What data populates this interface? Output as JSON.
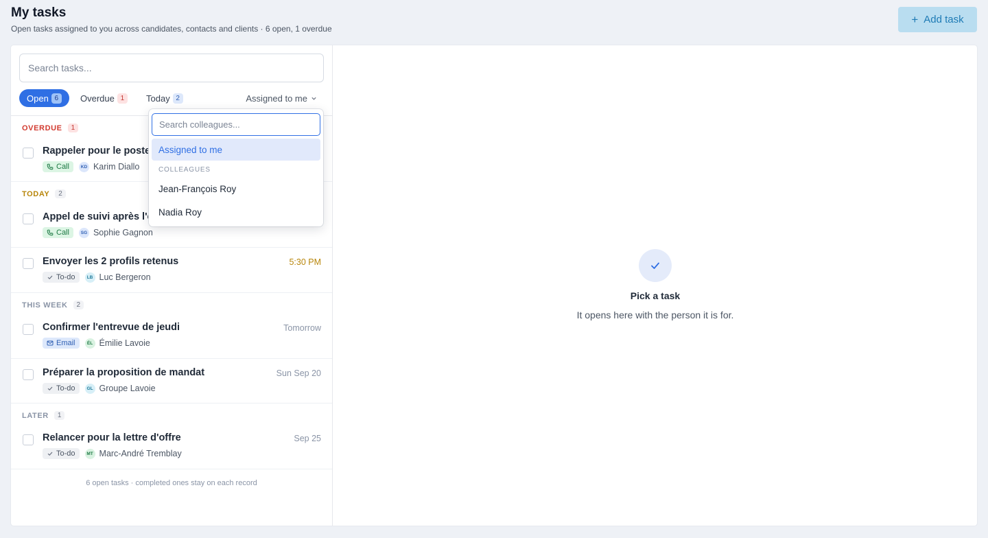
{
  "header": {
    "title": "My tasks",
    "subtitle": "Open tasks assigned to you across candidates, contacts and clients · 6 open, 1 overdue",
    "add_task_label": "Add task"
  },
  "search": {
    "placeholder": "Search tasks..."
  },
  "filters": {
    "open": {
      "label": "Open",
      "count": "6"
    },
    "overdue": {
      "label": "Overdue",
      "count": "1"
    },
    "today": {
      "label": "Today",
      "count": "2"
    },
    "assigned": {
      "label": "Assigned to me"
    }
  },
  "sections": {
    "overdue": {
      "label": "OVERDUE",
      "count": "1"
    },
    "today": {
      "label": "TODAY",
      "count": "2"
    },
    "this_week": {
      "label": "THIS WEEK",
      "count": "2"
    },
    "later": {
      "label": "LATER",
      "count": "1"
    }
  },
  "tasks": [
    {
      "title": "Rappeler pour le poste",
      "type": "Call",
      "initials": "KD",
      "person": "Karim Diallo",
      "due": ""
    },
    {
      "title": "Appel de suivi après l'e",
      "type": "Call",
      "initials": "SG",
      "person": "Sophie Gagnon",
      "due": ""
    },
    {
      "title": "Envoyer les 2 profils retenus",
      "type": "To-do",
      "initials": "LB",
      "person": "Luc Bergeron",
      "due": "5:30 PM"
    },
    {
      "title": "Confirmer l'entrevue de jeudi",
      "type": "Email",
      "initials": "ÉL",
      "person": "Émilie Lavoie",
      "due": "Tomorrow"
    },
    {
      "title": "Préparer la proposition de mandat",
      "type": "To-do",
      "initials": "GL",
      "person": "Groupe Lavoie",
      "due": "Sun Sep 20"
    },
    {
      "title": "Relancer pour la lettre d'offre",
      "type": "To-do",
      "initials": "MT",
      "person": "Marc-André Tremblay",
      "due": "Sep 25"
    }
  ],
  "footer": "6 open tasks · completed ones stay on each record",
  "detail": {
    "title": "Pick a task",
    "subtitle": "It opens here with the person it is for."
  },
  "dropdown": {
    "placeholder": "Search colleagues...",
    "selected": "Assigned to me",
    "section_label": "COLLEAGUES",
    "colleagues": [
      "Jean-François Roy",
      "Nadia Roy"
    ]
  },
  "colors": {
    "accent": "#2f6fe4",
    "overdue": "#d23a2f",
    "today": "#b8860b",
    "add_button_bg": "#b9ddf0"
  }
}
